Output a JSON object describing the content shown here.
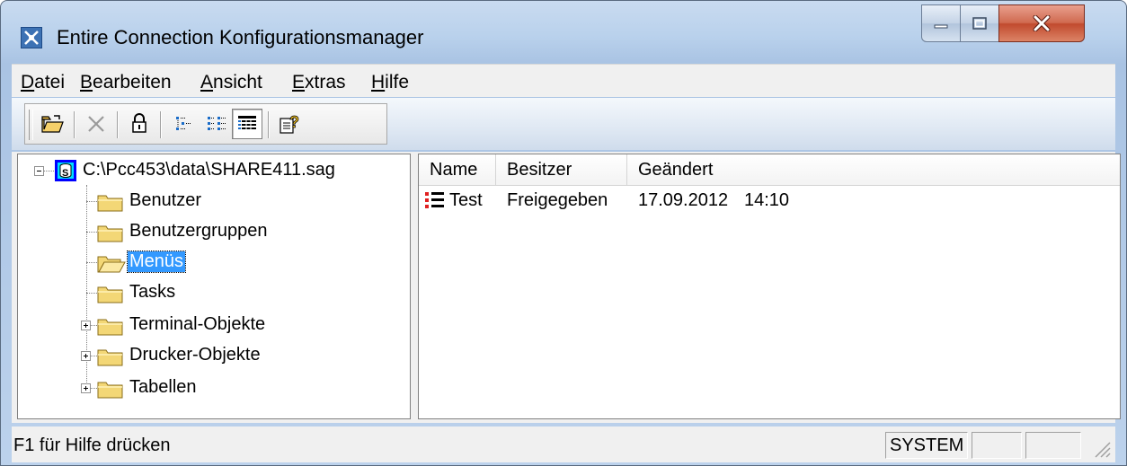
{
  "window": {
    "title": "Entire Connection Konfigurationsmanager"
  },
  "menubar": {
    "items": [
      {
        "label": "Datei",
        "accel": "D",
        "rest": "atei"
      },
      {
        "label": "Bearbeiten",
        "accel": "B",
        "rest": "earbeiten"
      },
      {
        "label": "Ansicht",
        "accel": "A",
        "rest": "nsicht"
      },
      {
        "label": "Extras",
        "accel": "E",
        "rest": "xtras"
      },
      {
        "label": "Hilfe",
        "accel": "H",
        "rest": "ilfe"
      }
    ]
  },
  "toolbar": {
    "buttons": [
      "open-icon",
      "delete-icon",
      "lock-icon",
      "small-icons-view-icon",
      "list-view-icon",
      "details-view-icon",
      "help-icon"
    ],
    "pressed": "details-view-icon"
  },
  "tree": {
    "root": "C:\\Pcc453\\data\\SHARE411.sag",
    "items": [
      {
        "label": "Benutzer",
        "expandable": false,
        "selected": false
      },
      {
        "label": "Benutzergruppen",
        "expandable": false,
        "selected": false
      },
      {
        "label": "Menüs",
        "expandable": false,
        "selected": true
      },
      {
        "label": "Tasks",
        "expandable": false,
        "selected": false
      },
      {
        "label": "Terminal-Objekte",
        "expandable": true,
        "selected": false
      },
      {
        "label": "Drucker-Objekte",
        "expandable": true,
        "selected": false
      },
      {
        "label": "Tabellen",
        "expandable": true,
        "selected": false
      }
    ]
  },
  "list": {
    "columns": [
      "Name",
      "Besitzer",
      "Geändert"
    ],
    "rows": [
      {
        "name": "Test",
        "owner": "Freigegeben",
        "date": "17.09.2012",
        "time": "14:10"
      }
    ]
  },
  "status": {
    "text": "F1 für Hilfe drücken",
    "panes": [
      "SYSTEM",
      "",
      ""
    ]
  },
  "colors": {
    "selection": "#3399ff",
    "titlebar": "#b9d1ec",
    "close": "#c14a2e"
  }
}
